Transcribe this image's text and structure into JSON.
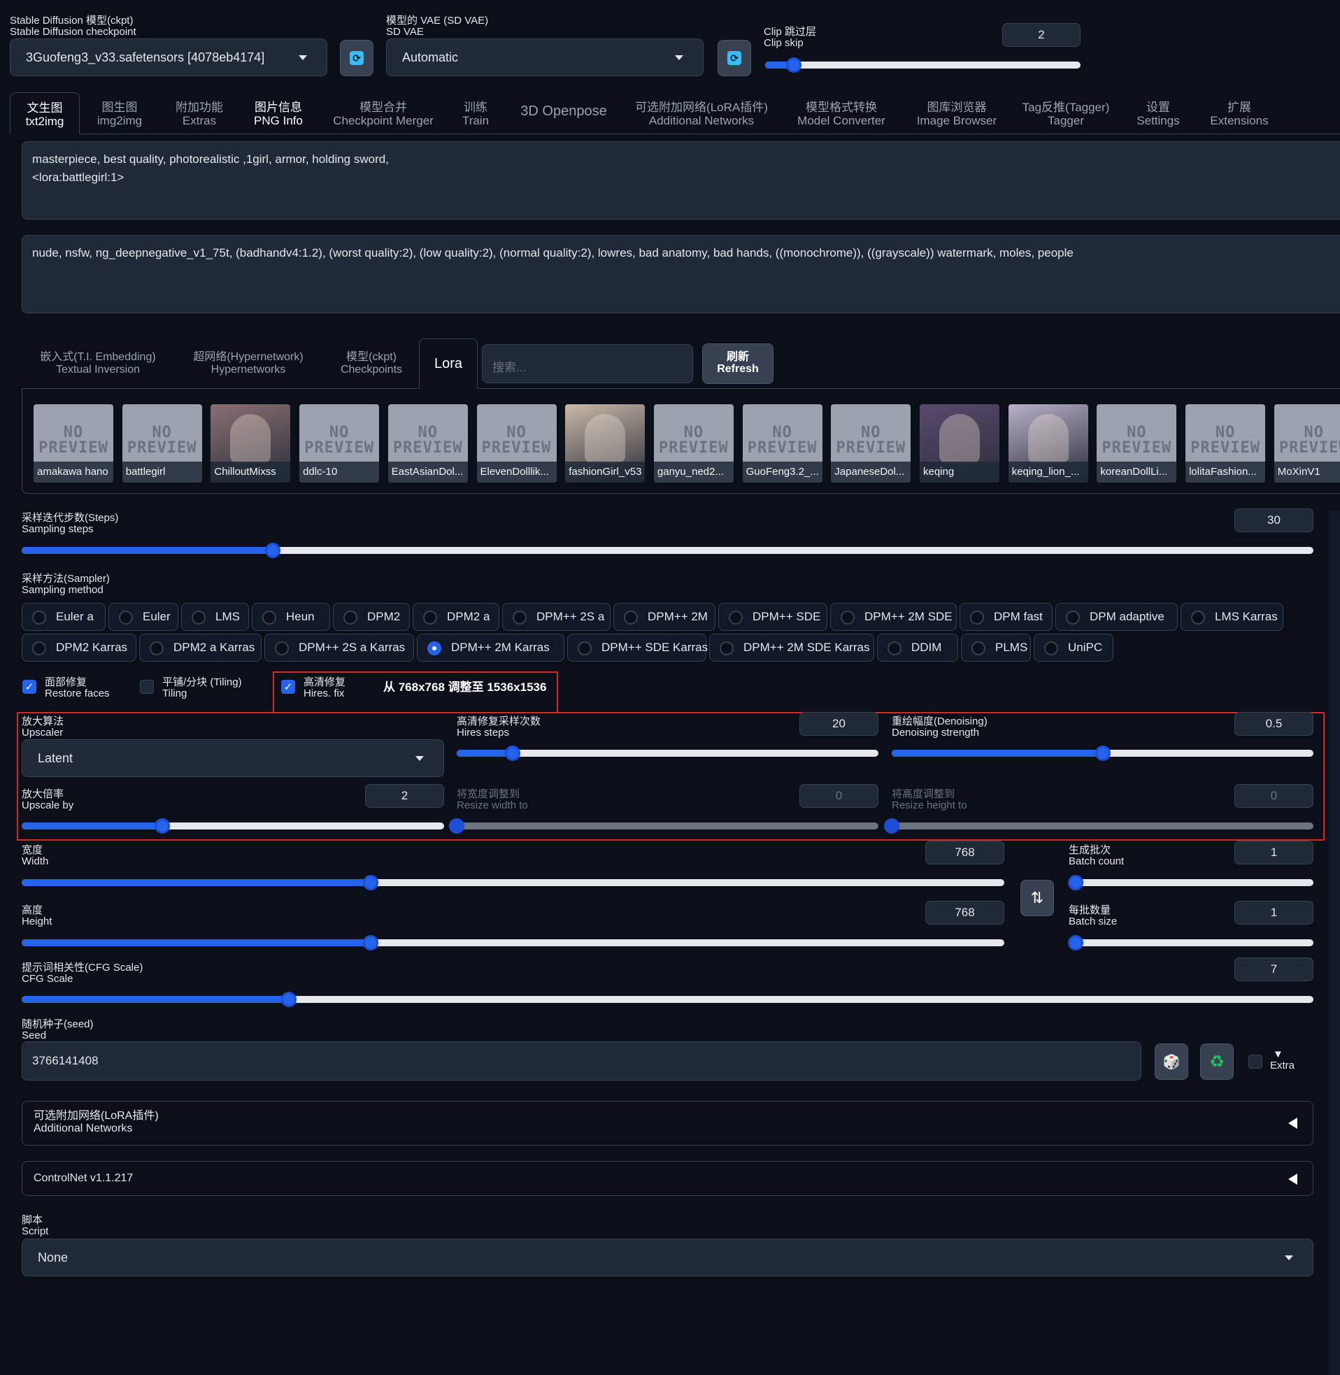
{
  "top": {
    "checkpoint": {
      "label_cn": "Stable Diffusion 模型(ckpt)",
      "label_en": "Stable Diffusion checkpoint",
      "value": "3Guofeng3_v33.safetensors [4078eb4174]"
    },
    "vae": {
      "label_cn": "模型的 VAE (SD VAE)",
      "label_en": "SD VAE",
      "value": "Automatic"
    },
    "clip_skip": {
      "label_cn": "Clip 跳过层",
      "label_en": "Clip skip",
      "value": "2",
      "min": 1,
      "max": 12
    }
  },
  "tabs": [
    {
      "cn": "文生图",
      "en": "txt2img"
    },
    {
      "cn": "图生图",
      "en": "img2img"
    },
    {
      "cn": "附加功能",
      "en": "Extras"
    },
    {
      "cn": "图片信息",
      "en": "PNG Info"
    },
    {
      "cn": "模型合并",
      "en": "Checkpoint Merger"
    },
    {
      "cn": "训练",
      "en": "Train"
    },
    {
      "cn": "3D Openpose",
      "en": ""
    },
    {
      "cn": "可选附加网络(LoRA插件)",
      "en": "Additional Networks"
    },
    {
      "cn": "模型格式转换",
      "en": "Model Converter"
    },
    {
      "cn": "图库浏览器",
      "en": "Image Browser"
    },
    {
      "cn": "Tag反推(Tagger)",
      "en": "Tagger"
    },
    {
      "cn": "设置",
      "en": "Settings"
    },
    {
      "cn": "扩展",
      "en": "Extensions"
    }
  ],
  "prompt": "masterpiece, best quality, photorealistic ,1girl, armor, holding sword,\n<lora:battlegirl:1>",
  "negative_prompt": "nude, nsfw, ng_deepnegative_v1_75t, (badhandv4:1.2), (worst quality:2), (low quality:2), (normal quality:2), lowres, bad anatomy, bad hands, ((monochrome)), ((grayscale)) watermark, moles, people",
  "extra_networks": {
    "tabs": [
      {
        "cn": "嵌入式(T.I. Embedding)",
        "en": "Textual Inversion"
      },
      {
        "cn": "超网络(Hypernetwork)",
        "en": "Hypernetworks"
      },
      {
        "cn": "模型(ckpt)",
        "en": "Checkpoints"
      },
      {
        "cn": "Lora",
        "en": ""
      }
    ],
    "search_placeholder": "搜索...",
    "refresh_cn": "刷新",
    "refresh_en": "Refresh",
    "no_preview_line1": "NO",
    "no_preview_line2": "PREVIEW",
    "cards": [
      {
        "name": "amakawa hano",
        "preview": false
      },
      {
        "name": "battlegirl",
        "preview": false
      },
      {
        "name": "ChilloutMixss",
        "preview": true,
        "tone": "#8a6f74"
      },
      {
        "name": "ddlc-10",
        "preview": false
      },
      {
        "name": "EastAsianDol...",
        "preview": false
      },
      {
        "name": "ElevenDolllik...",
        "preview": false
      },
      {
        "name": "fashionGirl_v53",
        "preview": true,
        "tone": "#c9b9a8"
      },
      {
        "name": "ganyu_ned2...",
        "preview": false
      },
      {
        "name": "GuoFeng3.2_...",
        "preview": false
      },
      {
        "name": "JapaneseDol...",
        "preview": false
      },
      {
        "name": "keqing",
        "preview": true,
        "tone": "#5a4a6e"
      },
      {
        "name": "keqing_lion_...",
        "preview": true,
        "tone": "#b8b0c8"
      },
      {
        "name": "koreanDollLi...",
        "preview": false
      },
      {
        "name": "lolitaFashion...",
        "preview": false
      },
      {
        "name": "MoXinV1",
        "preview": false
      }
    ]
  },
  "steps": {
    "label_cn": "采样迭代步数(Steps)",
    "label_en": "Sampling steps",
    "value": "30",
    "min": 1,
    "max": 150
  },
  "sampler": {
    "label_cn": "采样方法(Sampler)",
    "label_en": "Sampling method",
    "selected": "DPM++ 2M Karras",
    "row1": [
      "Euler a",
      "Euler",
      "LMS",
      "Heun",
      "DPM2",
      "DPM2 a",
      "DPM++ 2S a",
      "DPM++ 2M",
      "DPM++ SDE",
      "DPM++ 2M SDE",
      "DPM fast",
      "DPM adaptive",
      "LMS Karras"
    ],
    "row2": [
      "DPM2 Karras",
      "DPM2 a Karras",
      "DPM++ 2S a Karras",
      "DPM++ 2M Karras",
      "DPM++ SDE Karras",
      "DPM++ 2M SDE Karras",
      "DDIM",
      "PLMS",
      "UniPC"
    ]
  },
  "checks": {
    "restore_faces": {
      "cn": "面部修复",
      "en": "Restore faces",
      "checked": true
    },
    "tiling": {
      "cn": "平铺/分块 (Tiling)",
      "en": "Tiling",
      "checked": false
    },
    "hires_fix": {
      "cn": "高清修复",
      "en": "Hires. fix",
      "checked": true
    },
    "hires_info": "从 768x768 调整至 1536x1536"
  },
  "hires": {
    "upscaler": {
      "label_cn": "放大算法",
      "label_en": "Upscaler",
      "value": "Latent"
    },
    "steps": {
      "label_cn": "高清修复采样次数",
      "label_en": "Hires steps",
      "value": "20",
      "min": 0,
      "max": 150
    },
    "denoise": {
      "label_cn": "重绘幅度(Denoising)",
      "label_en": "Denoising strength",
      "value": "0.5",
      "min": 0,
      "max": 1
    },
    "scale": {
      "label_cn": "放大倍率",
      "label_en": "Upscale by",
      "value": "2",
      "min": 1,
      "max": 4
    },
    "resize_w": {
      "label_cn": "将宽度调整到",
      "label_en": "Resize width to",
      "value": "0",
      "min": 0,
      "max": 2048
    },
    "resize_h": {
      "label_cn": "将高度调整到",
      "label_en": "Resize height to",
      "value": "0",
      "min": 0,
      "max": 2048
    }
  },
  "size": {
    "width": {
      "label_cn": "宽度",
      "label_en": "Width",
      "value": "768",
      "min": 64,
      "max": 2048
    },
    "height": {
      "label_cn": "高度",
      "label_en": "Height",
      "value": "768",
      "min": 64,
      "max": 2048
    },
    "swap_icon": "⇅"
  },
  "batch": {
    "count": {
      "label_cn": "生成批次",
      "label_en": "Batch count",
      "value": "1",
      "min": 1,
      "max": 100
    },
    "size": {
      "label_cn": "每批数量",
      "label_en": "Batch size",
      "value": "1",
      "min": 1,
      "max": 8
    }
  },
  "cfg": {
    "label_cn": "提示词相关性(CFG Scale)",
    "label_en": "CFG Scale",
    "value": "7",
    "min": 1,
    "max": 30
  },
  "seed": {
    "label_cn": "随机种子(seed)",
    "label_en": "Seed",
    "value": "3766141408",
    "extra": "Extra",
    "dice_icon": "🎲",
    "recycle_icon": "♻",
    "extra_icon": "▼"
  },
  "accordions": {
    "additional_networks": {
      "cn": "可选附加网络(LoRA插件)",
      "en": "Additional Networks"
    },
    "controlnet": "ControlNet v1.1.217"
  },
  "script": {
    "label_cn": "脚本",
    "label_en": "Script",
    "value": "None"
  },
  "colors": {
    "accent": "#2563eb",
    "background": "#0b0f19",
    "panel": "#1f2937",
    "highlight": "#dc2626"
  }
}
